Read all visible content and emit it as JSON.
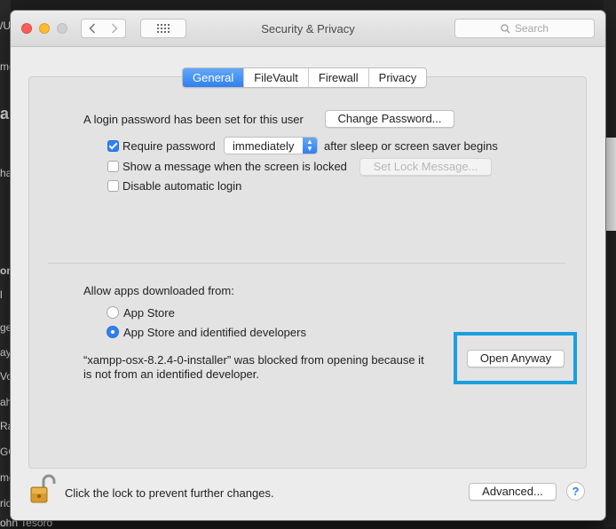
{
  "background": {
    "left_fragments": [
      "/U",
      "me",
      "ail",
      "ha",
      "ons",
      "l",
      "ges",
      "ay",
      "Vo",
      "ah",
      "Ra",
      "GO",
      "me",
      "rio",
      "ohn Tesoro"
    ]
  },
  "window": {
    "title": "Security & Privacy",
    "search_placeholder": "Search"
  },
  "tabs": [
    {
      "label": "General",
      "active": true
    },
    {
      "label": "FileVault",
      "active": false
    },
    {
      "label": "Firewall",
      "active": false
    },
    {
      "label": "Privacy",
      "active": false
    }
  ],
  "general": {
    "login_password_text": "A login password has been set for this user",
    "change_password_label": "Change Password...",
    "require_password_label": "Require password",
    "require_password_checked": true,
    "require_password_delay": "immediately",
    "require_password_suffix": "after sleep or screen saver begins",
    "show_message_label": "Show a message when the screen is locked",
    "show_message_checked": false,
    "set_lock_message_label": "Set Lock Message...",
    "disable_auto_login_label": "Disable automatic login",
    "disable_auto_login_checked": false
  },
  "downloads": {
    "heading": "Allow apps downloaded from:",
    "option_app_store": "App Store",
    "option_identified": "App Store and identified developers",
    "selected": "App Store and identified developers",
    "blocked_line1": "“xampp-osx-8.2.4-0-installer” was blocked from opening because it",
    "blocked_line2": "is not from an identified developer.",
    "open_anyway_label": "Open Anyway"
  },
  "footer": {
    "lock_text": "Click the lock to prevent further changes.",
    "advanced_label": "Advanced...",
    "help_label": "?"
  },
  "colors": {
    "accent": "#2f7ff0",
    "highlight_box": "#1a9fe0"
  }
}
